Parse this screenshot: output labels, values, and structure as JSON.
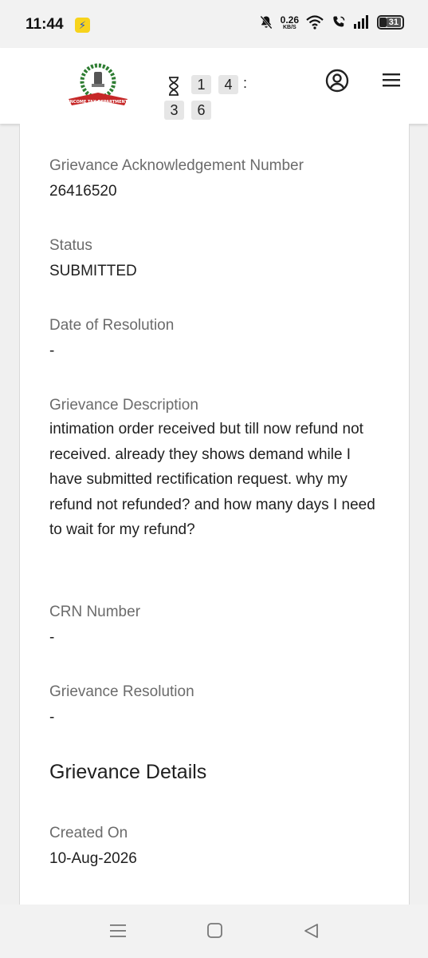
{
  "status_bar": {
    "time": "11:44",
    "net_speed_value": "0.26",
    "net_speed_unit": "KB/S",
    "battery": "31"
  },
  "header": {
    "logo_text": "INCOME TAX DEPARTMENT",
    "timer_digits": [
      "1",
      "4",
      "3",
      "6"
    ],
    "timer_separator": ":"
  },
  "details": {
    "ack_label": "Grievance Acknowledgement Number",
    "ack_value": "26416520",
    "status_label": "Status",
    "status_value": "SUBMITTED",
    "resolution_date_label": "Date of Resolution",
    "resolution_date_value": "-",
    "description_label": "Grievance Description",
    "description_value": "intimation order received but till now refund not received. already they shows demand while I have submitted rectification request. why my refund not refunded? and how many days I need to wait for my refund?",
    "crn_label": "CRN Number",
    "crn_value": "-",
    "resolution_label": "Grievance Resolution",
    "resolution_value": "-"
  },
  "grievance_details": {
    "title": "Grievance Details",
    "created_label": "Created On",
    "created_value": "10-Aug-2026"
  },
  "colors": {
    "header_bg": "#ffffff",
    "label_gray": "#6b6b6b",
    "value_dark": "#1f1f1f",
    "logo_green": "#2e7d32",
    "logo_red": "#c62828"
  }
}
